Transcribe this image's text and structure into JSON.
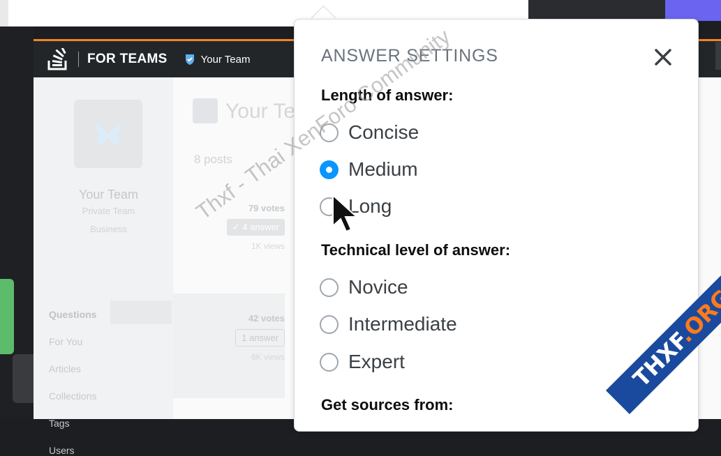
{
  "header": {
    "product": "FOR TEAMS",
    "team_name": "Your Team"
  },
  "sidebar": {
    "team_name": "Your Team",
    "team_type": "Private Team",
    "plan": "Business",
    "items": [
      {
        "label": "Questions",
        "active": true
      },
      {
        "label": "For You"
      },
      {
        "label": "Articles"
      },
      {
        "label": "Collections"
      },
      {
        "label": "Tags"
      },
      {
        "label": "Users"
      }
    ]
  },
  "main": {
    "title": "Your Team",
    "posts_count": "8 posts",
    "posts": [
      {
        "votes": "79 votes",
        "answers": "4 answer",
        "views": "1K views"
      },
      {
        "votes": "42 votes",
        "answers": "1 answer",
        "views": "6K views"
      }
    ]
  },
  "popup": {
    "title": "ANSWER SETTINGS",
    "close_icon": "close-icon",
    "length_label": "Length of answer:",
    "length_options": [
      "Concise",
      "Medium",
      "Long"
    ],
    "length_selected": "Medium",
    "level_label": "Technical level of answer:",
    "level_options": [
      "Novice",
      "Intermediate",
      "Expert"
    ],
    "level_selected": null,
    "sources_label": "Get sources from:"
  },
  "watermarks": {
    "diagonal": "Thxf - Thai XenForo Community",
    "banner_prefix": "THXF",
    "banner_suffix": ".ORG"
  },
  "colors": {
    "accent_orange": "#f48225",
    "radio_blue": "#0a95ff",
    "purple": "#6a64f0",
    "green": "#5dbb6c"
  }
}
